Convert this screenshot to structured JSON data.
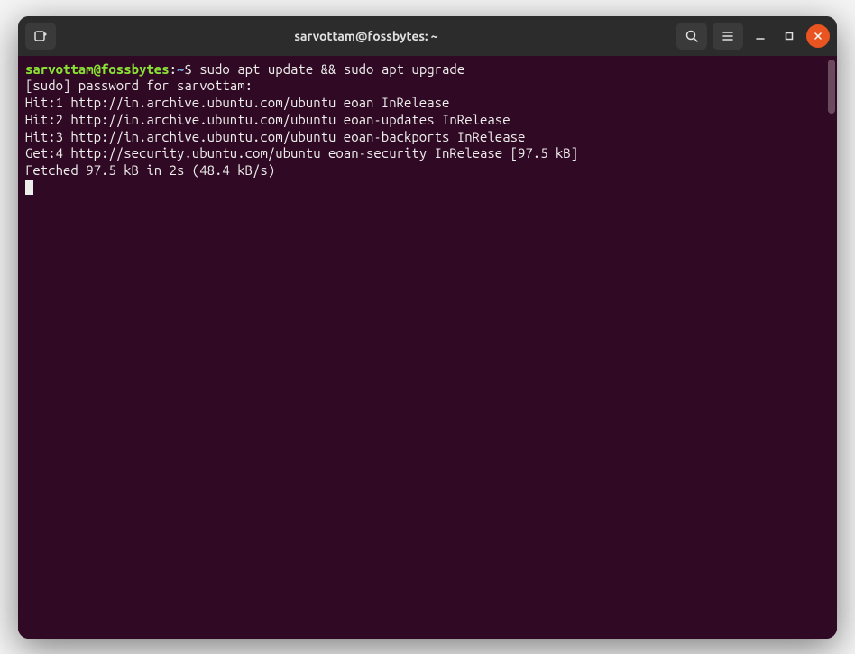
{
  "titlebar": {
    "title": "sarvottam@fossbytes: ~"
  },
  "prompt": {
    "user_host": "sarvottam@fossbytes",
    "colon": ":",
    "path": "~",
    "dollar": "$ "
  },
  "command": "sudo apt update && sudo apt upgrade",
  "output": {
    "line1": "[sudo] password for sarvottam:",
    "line2": "Hit:1 http://in.archive.ubuntu.com/ubuntu eoan InRelease",
    "line3": "Hit:2 http://in.archive.ubuntu.com/ubuntu eoan-updates InRelease",
    "line4": "Hit:3 http://in.archive.ubuntu.com/ubuntu eoan-backports InRelease",
    "line5": "Get:4 http://security.ubuntu.com/ubuntu eoan-security InRelease [97.5 kB]",
    "line6": "Fetched 97.5 kB in 2s (48.4 kB/s)"
  }
}
